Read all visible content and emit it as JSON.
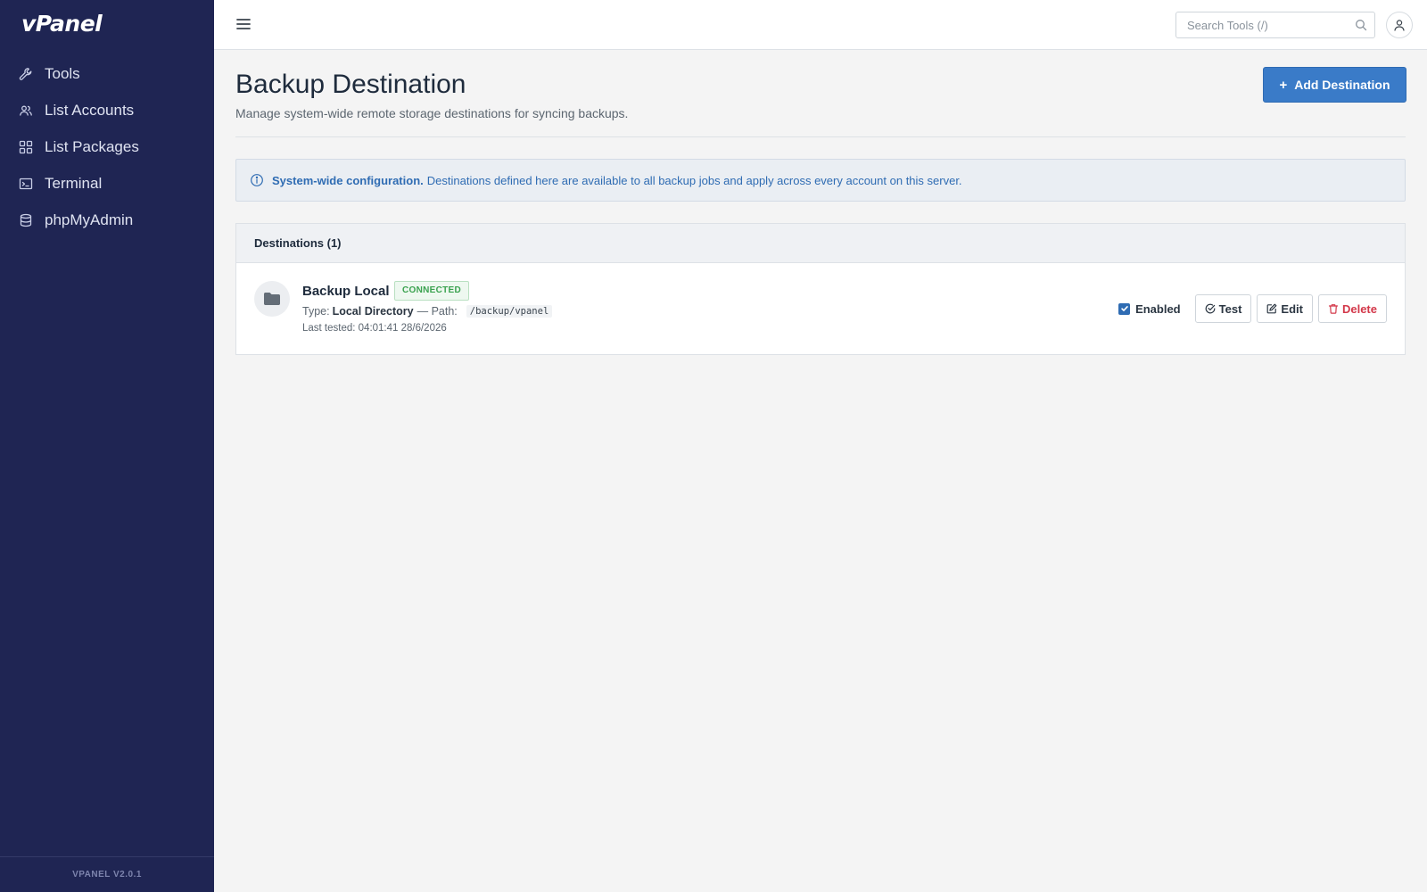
{
  "app": {
    "logo": "vPanel",
    "version": "VPANEL V2.0.1"
  },
  "sidebar": {
    "items": [
      {
        "label": "Tools",
        "icon": "wrench-icon"
      },
      {
        "label": "List Accounts",
        "icon": "users-icon"
      },
      {
        "label": "List Packages",
        "icon": "grid-icon"
      },
      {
        "label": "Terminal",
        "icon": "terminal-icon"
      },
      {
        "label": "phpMyAdmin",
        "icon": "database-icon"
      }
    ]
  },
  "topbar": {
    "search_placeholder": "Search Tools (/)"
  },
  "page": {
    "title": "Backup Destination",
    "subtitle": "Manage system-wide remote storage destinations for syncing backups.",
    "add_button_label": "Add Destination"
  },
  "info": {
    "strong": "System-wide configuration.",
    "text": "Destinations defined here are available to all backup jobs and apply across every account on this server."
  },
  "destinations": {
    "header": "Destinations (1)",
    "items": [
      {
        "name": "Backup Local",
        "status": "CONNECTED",
        "type_label": "Type:",
        "type_value": "Local Directory",
        "path_label": "— Path:",
        "path_value": "/backup/vpanel",
        "last_tested": "Last tested: 04:01:41 28/6/2026",
        "enabled_label": "Enabled",
        "enabled": true,
        "test_label": "Test",
        "edit_label": "Edit",
        "delete_label": "Delete"
      }
    ]
  },
  "colors": {
    "sidebar_bg": "#1f2553",
    "primary": "#3a7bc8",
    "success": "#3aa24f",
    "danger": "#d3384a"
  }
}
